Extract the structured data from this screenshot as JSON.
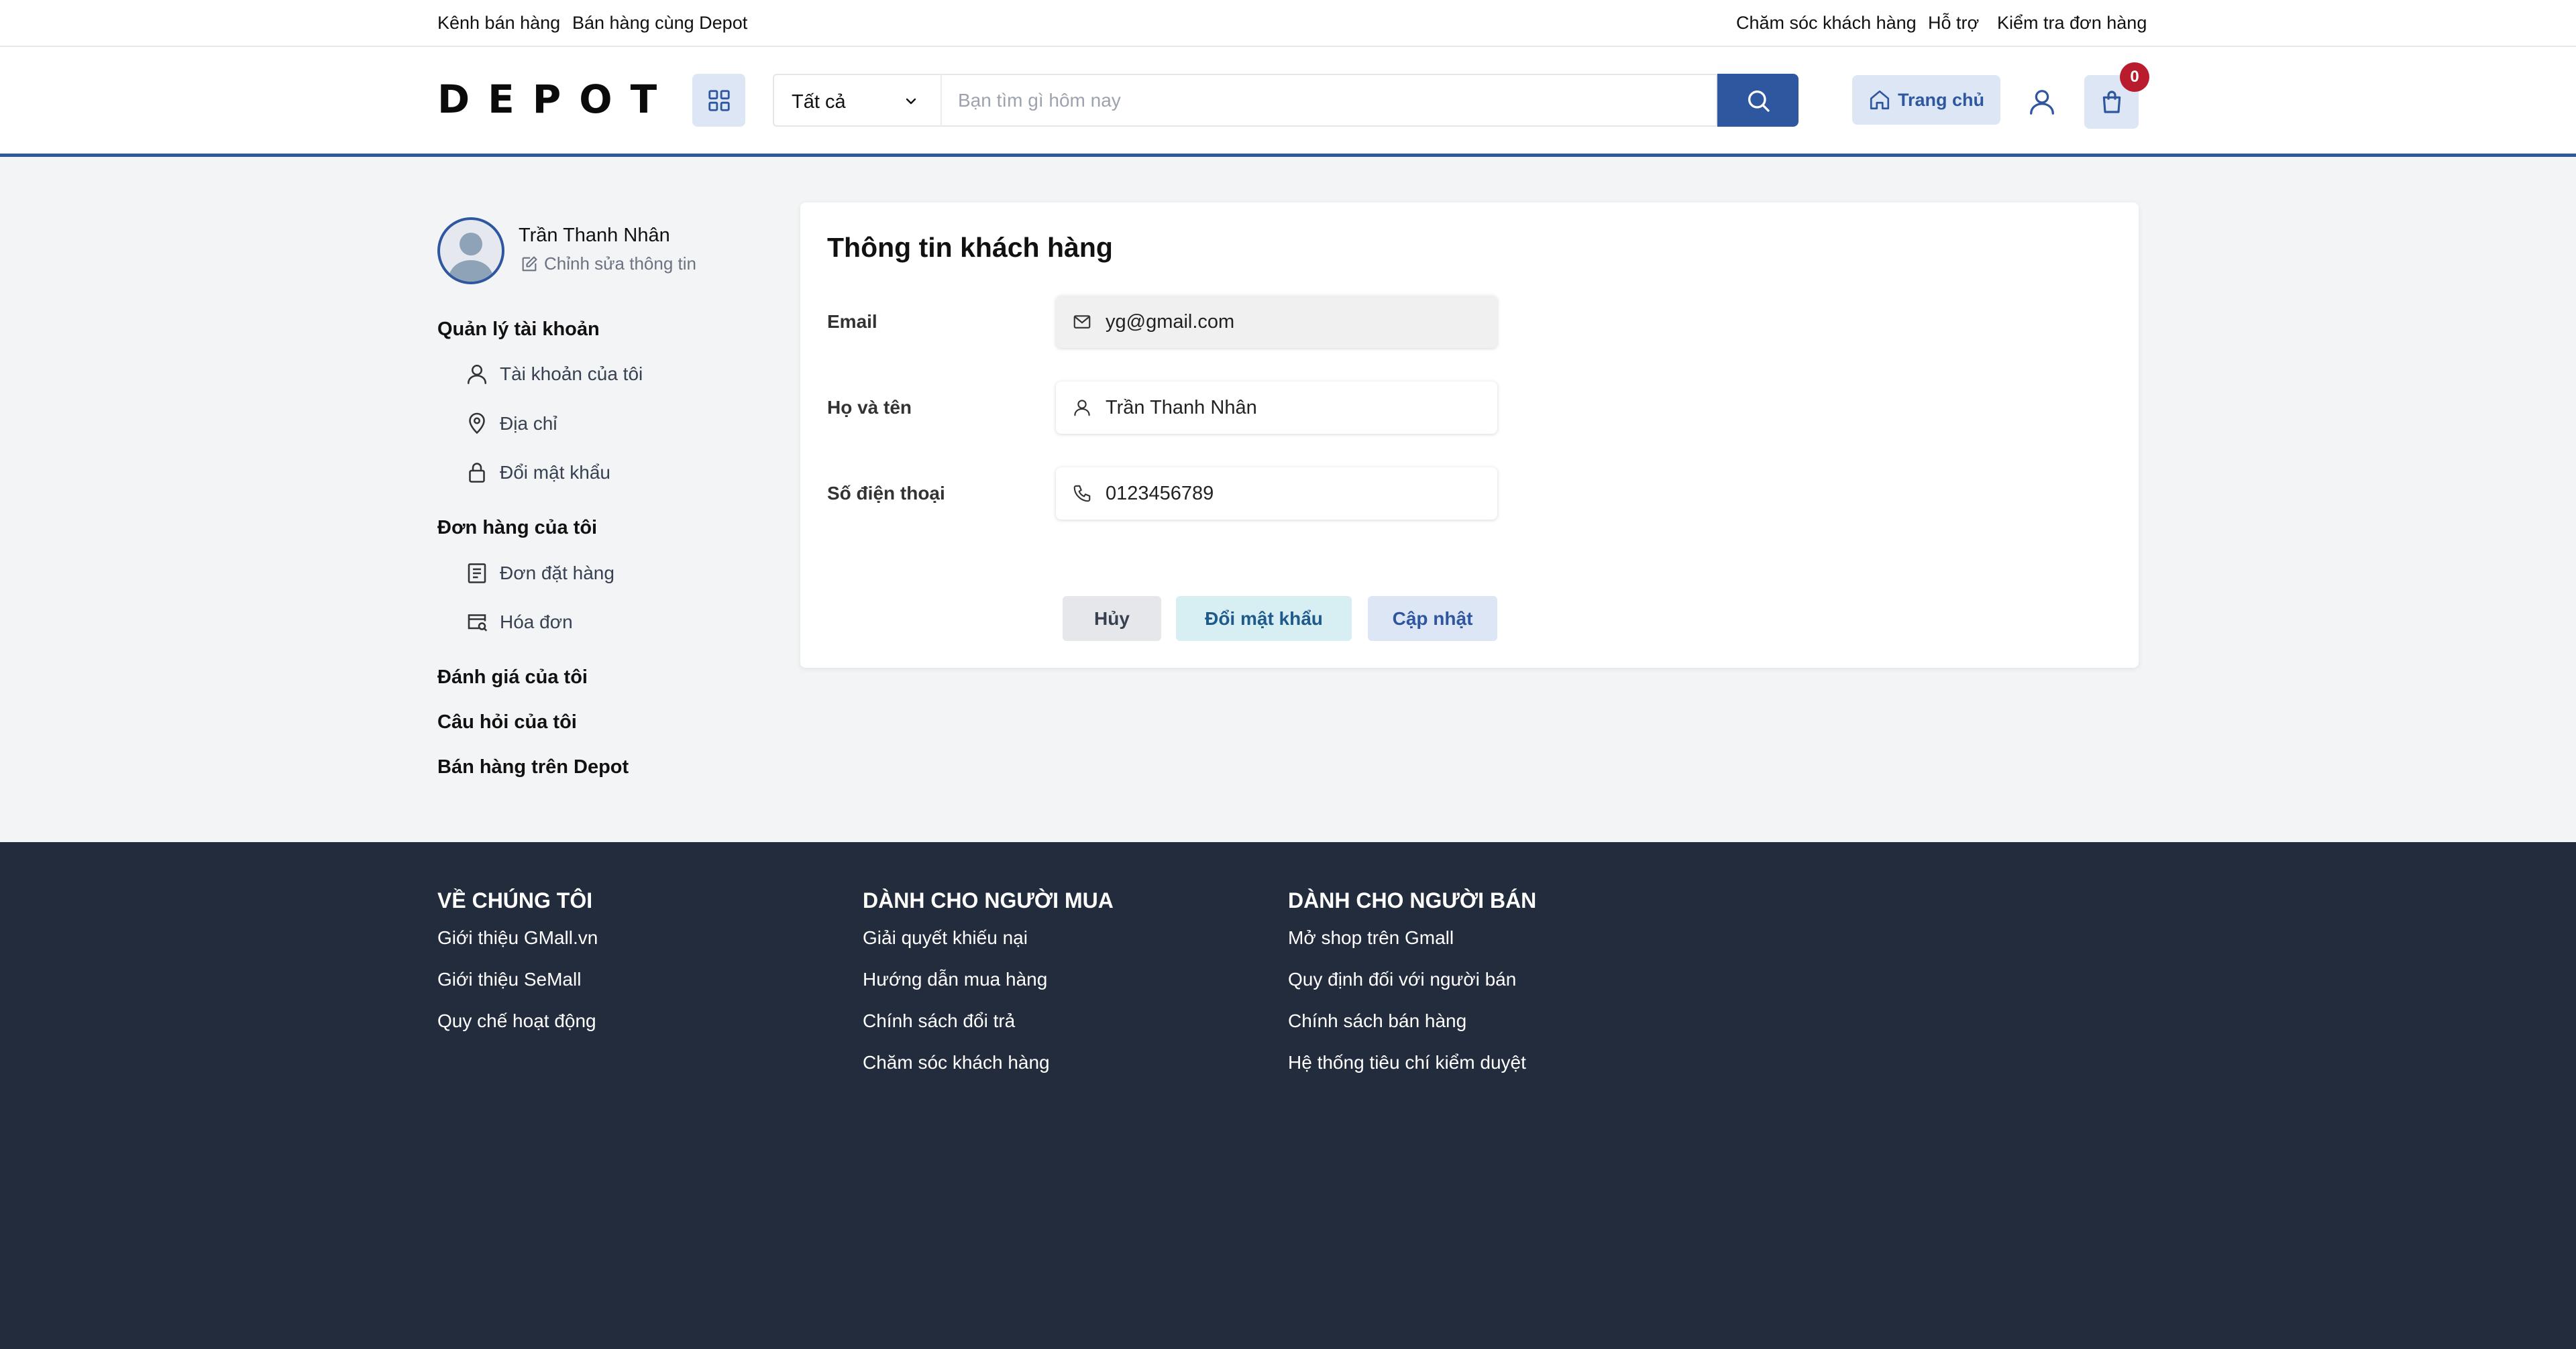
{
  "topbar": {
    "left_links": [
      "Kênh bán hàng",
      "Bán hàng cùng Depot"
    ],
    "right_links": [
      "Chăm sóc khách hàng",
      "Hỗ trợ",
      "Kiểm tra đơn hàng"
    ]
  },
  "header": {
    "logo": "DEPOT",
    "category_selected": "Tất cả",
    "search_placeholder": "Bạn tìm gì hôm nay",
    "home_label": "Trang chủ",
    "cart_count": "0",
    "accent_color": "#2f579f",
    "badge_color": "#b91c2c"
  },
  "sidebar": {
    "user_name": "Trần Thanh Nhân",
    "edit_label": "Chỉnh sửa thông tin",
    "sections": [
      {
        "title": "Quản lý tài khoản",
        "items": [
          {
            "label": "Tài khoản của tôi",
            "icon": "user-icon"
          },
          {
            "label": "Địa chỉ",
            "icon": "map-pin-icon"
          },
          {
            "label": "Đổi mật khẩu",
            "icon": "lock-icon"
          }
        ]
      },
      {
        "title": "Đơn hàng của tôi",
        "items": [
          {
            "label": "Đơn đặt hàng",
            "icon": "receipt-icon"
          },
          {
            "label": "Hóa đơn",
            "icon": "invoice-search-icon"
          }
        ]
      },
      {
        "title": "Đánh giá của tôi",
        "items": []
      },
      {
        "title": "Câu hỏi của tôi",
        "items": []
      },
      {
        "title": "Bán hàng trên Depot",
        "items": []
      }
    ]
  },
  "profile": {
    "title": "Thông tin khách hàng",
    "fields": [
      {
        "label": "Email",
        "value": "yg@gmail.com",
        "icon": "mail-icon",
        "disabled": true
      },
      {
        "label": "Họ và tên",
        "value": "Trần Thanh Nhân",
        "icon": "user-icon",
        "disabled": false
      },
      {
        "label": "Số điện thoại",
        "value": "0123456789",
        "icon": "phone-icon",
        "disabled": false
      }
    ],
    "buttons": {
      "cancel": "Hủy",
      "change_password": "Đổi mật khẩu",
      "update": "Cập nhật"
    }
  },
  "footer": {
    "columns": [
      {
        "title": "VỀ CHÚNG TÔI",
        "links": [
          "Giới thiệu GMall.vn",
          "Giới thiệu SeMall",
          "Quy chế hoạt động"
        ]
      },
      {
        "title": "DÀNH CHO NGƯỜI MUA",
        "links": [
          "Giải quyết khiếu nại",
          "Hướng dẫn mua hàng",
          "Chính sách đổi trả",
          "Chăm sóc khách hàng"
        ]
      },
      {
        "title": "DÀNH CHO NGƯỜI BÁN",
        "links": [
          "Mở shop trên Gmall",
          "Quy định đối với người bán",
          "Chính sách bán hàng",
          "Hệ thống tiêu chí kiểm duyệt"
        ]
      }
    ],
    "background": "#232c3d"
  }
}
